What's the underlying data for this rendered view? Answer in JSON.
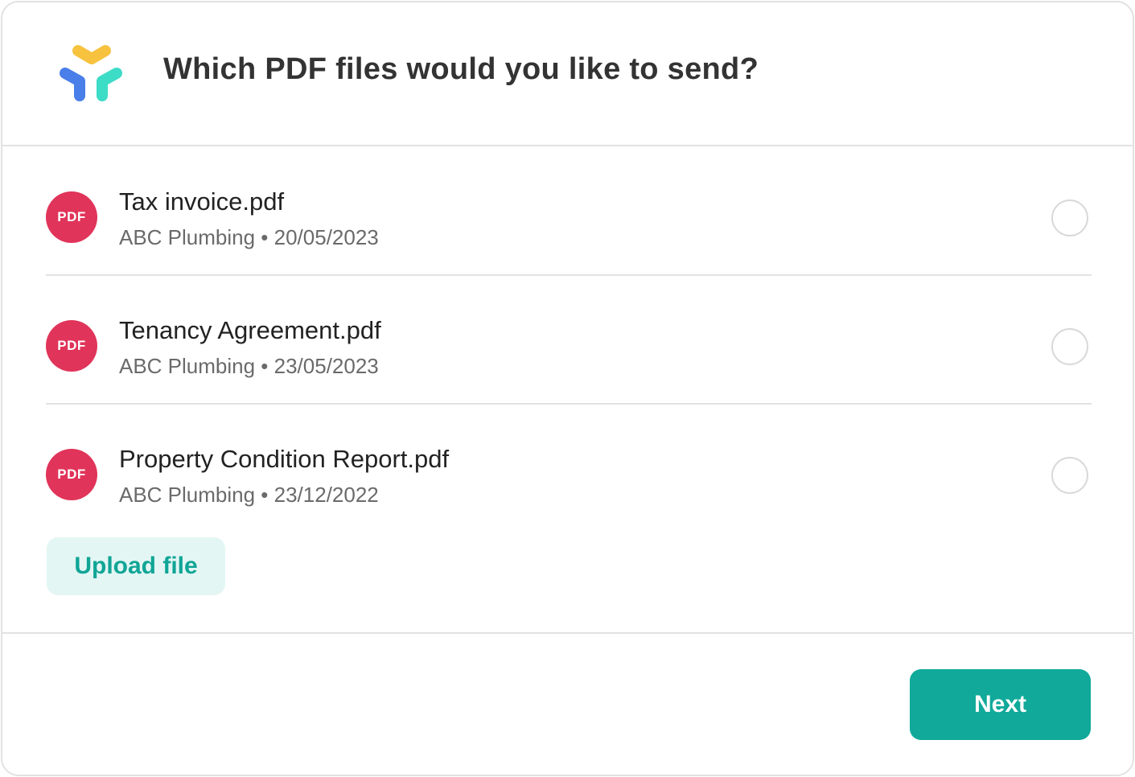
{
  "header": {
    "logo_icon": "app-logo-icon",
    "title": "Which PDF files would you like to send?"
  },
  "files": [
    {
      "badge": "PDF",
      "name": "Tax invoice.pdf",
      "meta": "ABC Plumbing • 20/05/2023",
      "selected": false
    },
    {
      "badge": "PDF",
      "name": "Tenancy Agreement.pdf",
      "meta": "ABC Plumbing • 23/05/2023",
      "selected": false
    },
    {
      "badge": "PDF",
      "name": "Property Condition Report.pdf",
      "meta": "ABC Plumbing • 23/12/2022",
      "selected": false
    }
  ],
  "actions": {
    "upload_label": "Upload file",
    "next_label": "Next"
  },
  "colors": {
    "pdf_badge": "#e1345a",
    "accent": "#10a99a",
    "upload_bg": "#e3f6f4",
    "logo_yellow": "#f7c23e",
    "logo_blue": "#4a7ee8",
    "logo_teal": "#3ddcc7"
  }
}
